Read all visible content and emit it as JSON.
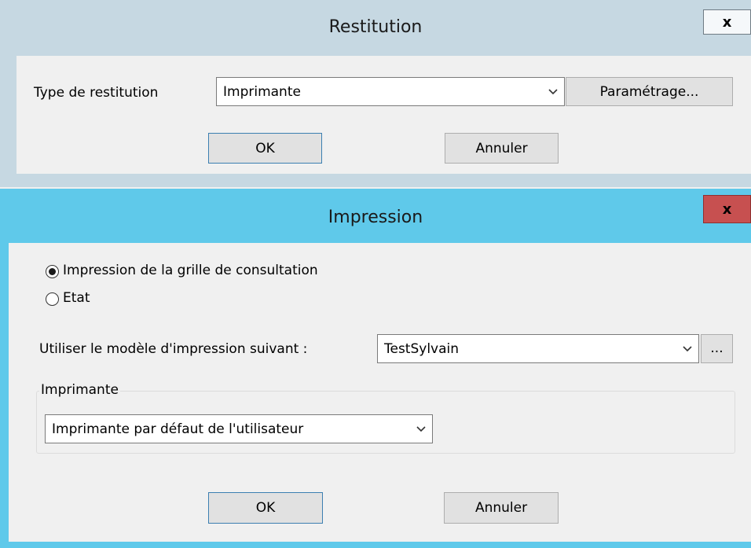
{
  "restitution_dialog": {
    "title": "Restitution",
    "close_glyph": "x",
    "type_label": "Type de restitution",
    "type_value": "Imprimante",
    "settings_button": "Paramétrage...",
    "ok_button": "OK",
    "cancel_button": "Annuler"
  },
  "impression_dialog": {
    "title": "Impression",
    "close_glyph": "x",
    "radio_options": [
      {
        "label": "Impression de la grille de consultation",
        "checked": true
      },
      {
        "label": "Etat",
        "checked": false
      }
    ],
    "template_label": "Utiliser le modèle d'impression suivant :",
    "template_value": "TestSylvain",
    "browse_button": "...",
    "printer_group_label": "Imprimante",
    "printer_value": "Imprimante par défaut de l'utilisateur",
    "ok_button": "OK",
    "cancel_button": "Annuler"
  },
  "colors": {
    "inactive_frame": "#c6d8e2",
    "active_frame": "#5fc9ea",
    "close_active": "#c75050",
    "client_bg": "#f0f0f0"
  }
}
